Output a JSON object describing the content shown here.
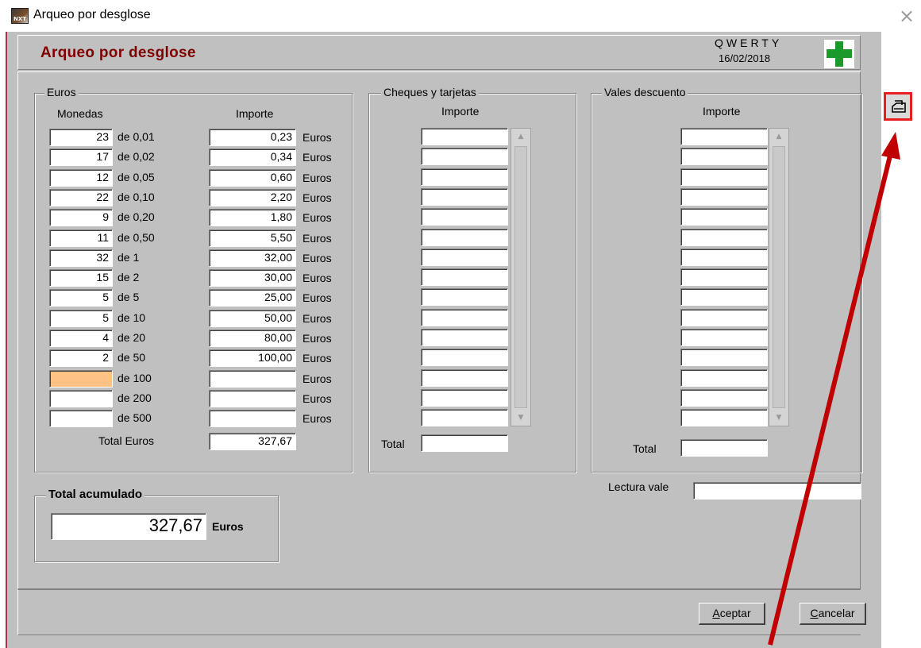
{
  "window": {
    "title": "Arqueo por desglose",
    "close_symbol": "×"
  },
  "header": {
    "title": "Arqueo por desglose",
    "company": "QWERTY",
    "date": "16/02/2018",
    "logo_icon": "green-cross-icon"
  },
  "euros": {
    "group_label": "Euros",
    "col_coins": "Monedas",
    "col_amount": "Importe",
    "unit": "Euros",
    "rows": [
      {
        "qty": "23",
        "denom": "de 0,01",
        "amount": "0,23"
      },
      {
        "qty": "17",
        "denom": "de 0,02",
        "amount": "0,34"
      },
      {
        "qty": "12",
        "denom": "de 0,05",
        "amount": "0,60"
      },
      {
        "qty": "22",
        "denom": "de 0,10",
        "amount": "2,20"
      },
      {
        "qty": "9",
        "denom": "de 0,20",
        "amount": "1,80"
      },
      {
        "qty": "11",
        "denom": "de 0,50",
        "amount": "5,50"
      },
      {
        "qty": "32",
        "denom": "de 1",
        "amount": "32,00"
      },
      {
        "qty": "15",
        "denom": "de 2",
        "amount": "30,00"
      },
      {
        "qty": "5",
        "denom": "de 5",
        "amount": "25,00"
      },
      {
        "qty": "5",
        "denom": "de 10",
        "amount": "50,00"
      },
      {
        "qty": "4",
        "denom": "de 20",
        "amount": "80,00"
      },
      {
        "qty": "2",
        "denom": "de 50",
        "amount": "100,00"
      },
      {
        "qty": "",
        "denom": "de 100",
        "amount": ""
      },
      {
        "qty": "",
        "denom": "de 200",
        "amount": ""
      },
      {
        "qty": "",
        "denom": "de 500",
        "amount": ""
      }
    ],
    "total_label": "Total Euros",
    "total_value": "327,67"
  },
  "cheques": {
    "group_label": "Cheques y tarjetas",
    "col_amount": "Importe",
    "total_label": "Total",
    "total_value": ""
  },
  "vales": {
    "group_label": "Vales descuento",
    "col_amount": "Importe",
    "total_label": "Total",
    "total_value": ""
  },
  "lectura": {
    "label": "Lectura vale",
    "value": ""
  },
  "accumulated": {
    "group_label": "Total acumulado",
    "value": "327,67",
    "unit": "Euros"
  },
  "buttons": {
    "accept_label": "Aceptar",
    "accept_hotkey": "A",
    "accept_rest": "ceptar",
    "cancel_label": "Cancelar",
    "cancel_hotkey": "C",
    "cancel_rest": "ancelar"
  },
  "side": {
    "print_icon": "print-icon"
  },
  "annotation": {
    "color": "#c00000",
    "highlight_color": "#ea1c24"
  }
}
